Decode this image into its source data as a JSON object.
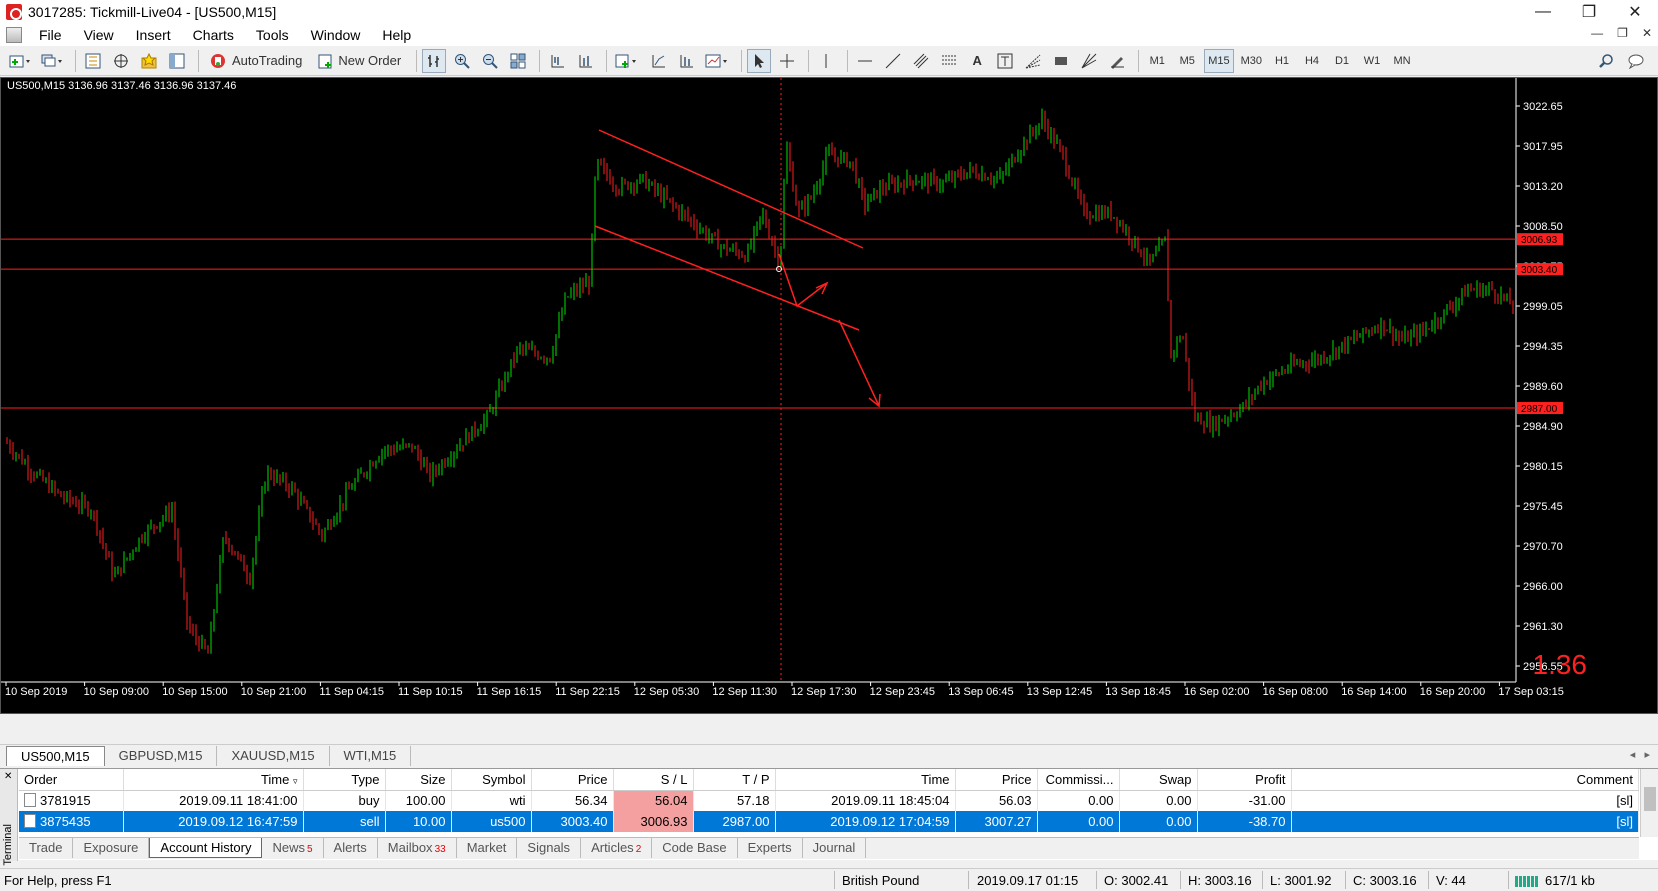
{
  "window": {
    "title": "3017285: Tickmill-Live04 - [US500,M15]"
  },
  "menu": [
    "File",
    "View",
    "Insert",
    "Charts",
    "Tools",
    "Window",
    "Help"
  ],
  "toolbar": {
    "autotrading_label": "AutoTrading",
    "new_order_label": "New Order",
    "timeframes": [
      "M1",
      "M5",
      "M15",
      "M30",
      "H1",
      "H4",
      "D1",
      "W1",
      "MN"
    ],
    "active_timeframe": "M15"
  },
  "chart": {
    "info": "US500,M15  3136.96 3137.46 3136.96 3137.46",
    "spread": "1.36",
    "price_labels": [
      "3022.65",
      "3017.95",
      "3013.20",
      "3008.50",
      "3003.75",
      "2999.05",
      "2994.35",
      "2989.60",
      "2984.90",
      "2980.15",
      "2975.45",
      "2970.70",
      "2966.00",
      "2961.30",
      "2956.55"
    ],
    "level_tags": [
      "3006.93",
      "3003.40",
      "2987.00"
    ],
    "time_labels": [
      "10 Sep 2019",
      "10 Sep 09:00",
      "10 Sep 15:00",
      "10 Sep 21:00",
      "11 Sep 04:15",
      "11 Sep 10:15",
      "11 Sep 16:15",
      "11 Sep 22:15",
      "12 Sep 05:30",
      "12 Sep 11:30",
      "12 Sep 17:30",
      "12 Sep 23:45",
      "13 Sep 06:45",
      "13 Sep 12:45",
      "13 Sep 18:45",
      "16 Sep 02:00",
      "16 Sep 08:00",
      "16 Sep 14:00",
      "16 Sep 20:00",
      "17 Sep 03:15"
    ],
    "colors": {
      "bull": "#00e000",
      "bear": "#ff2020",
      "lines": "#ff2020",
      "background": "#000000"
    }
  },
  "symbol_tabs": [
    "US500,M15",
    "GBPUSD,M15",
    "XAUUSD,M15",
    "WTI,M15"
  ],
  "terminal": {
    "label": "Terminal",
    "columns": [
      "Order",
      "Time",
      "Type",
      "Size",
      "Symbol",
      "Price",
      "S / L",
      "T / P",
      "Time",
      "Price",
      "Commissi...",
      "Swap",
      "Profit",
      "Comment"
    ],
    "rows": [
      [
        "3781915",
        "2019.09.11 18:41:00",
        "buy",
        "100.00",
        "wti",
        "56.34",
        "56.04",
        "57.18",
        "2019.09.11 18:45:04",
        "56.03",
        "0.00",
        "0.00",
        "-31.00",
        "[sl]"
      ],
      [
        "3875435",
        "2019.09.12 16:47:59",
        "sell",
        "10.00",
        "us500",
        "3003.40",
        "3006.93",
        "2987.00",
        "2019.09.12 17:04:59",
        "3007.27",
        "0.00",
        "0.00",
        "-38.70",
        "[sl]"
      ]
    ],
    "tabs": [
      {
        "label": "Trade",
        "badge": ""
      },
      {
        "label": "Exposure",
        "badge": ""
      },
      {
        "label": "Account History",
        "badge": ""
      },
      {
        "label": "News",
        "badge": "5"
      },
      {
        "label": "Alerts",
        "badge": ""
      },
      {
        "label": "Mailbox",
        "badge": "33"
      },
      {
        "label": "Market",
        "badge": ""
      },
      {
        "label": "Signals",
        "badge": ""
      },
      {
        "label": "Articles",
        "badge": "2"
      },
      {
        "label": "Code Base",
        "badge": ""
      },
      {
        "label": "Experts",
        "badge": ""
      },
      {
        "label": "Journal",
        "badge": ""
      }
    ],
    "active_tab": "Account History"
  },
  "status": {
    "help": "For Help, press F1",
    "profile": "British Pound",
    "datetime": "2019.09.17 01:15",
    "open": "O: 3002.41",
    "high": "H: 3003.16",
    "low": "L: 3001.92",
    "close": "C: 3003.16",
    "volume": "V: 44",
    "traffic": "617/1 kb"
  }
}
